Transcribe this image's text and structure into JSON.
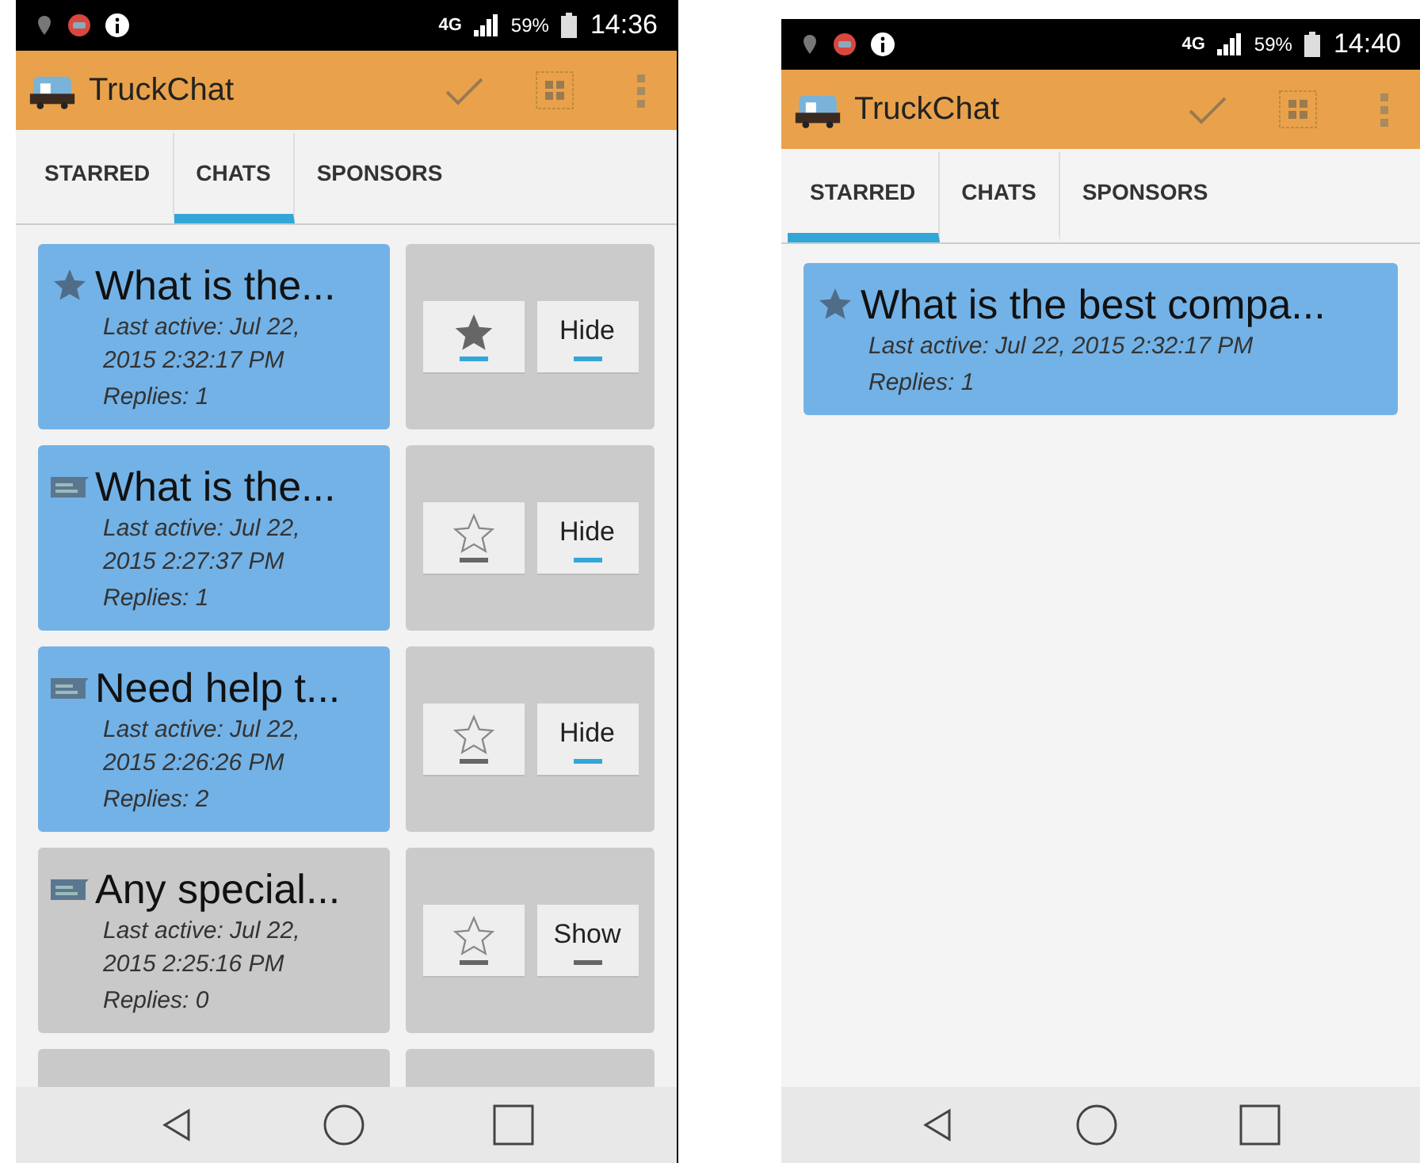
{
  "screens": [
    {
      "status_bar": {
        "network": "4G",
        "battery": "59%",
        "time": "14:36"
      },
      "app_title": "TruckChat",
      "tabs": [
        {
          "label": "STARRED",
          "selected": false
        },
        {
          "label": "CHATS",
          "selected": true
        },
        {
          "label": "SPONSORS",
          "selected": false
        }
      ],
      "threads": [
        {
          "title": "What is the...",
          "starred": true,
          "hidden": false,
          "last_active": "Last active: Jul 22, 2015 2:32:17 PM",
          "replies": "Replies: 1",
          "action": "Hide"
        },
        {
          "title": "What is the...",
          "starred": false,
          "hidden": false,
          "last_active": "Last active: Jul 22, 2015 2:27:37 PM",
          "replies": "Replies: 1",
          "action": "Hide"
        },
        {
          "title": "Need help t...",
          "starred": false,
          "hidden": false,
          "last_active": "Last active: Jul 22, 2015 2:26:26 PM",
          "replies": "Replies: 2",
          "action": "Hide"
        },
        {
          "title": "Any special...",
          "starred": false,
          "hidden": true,
          "last_active": "Last active: Jul 22, 2015 2:25:16 PM",
          "replies": "Replies: 0",
          "action": "Show"
        }
      ],
      "cut_off_row": true
    },
    {
      "status_bar": {
        "network": "4G",
        "battery": "59%",
        "time": "14:40"
      },
      "app_title": "TruckChat",
      "tabs": [
        {
          "label": "STARRED",
          "selected": true
        },
        {
          "label": "CHATS",
          "selected": false
        },
        {
          "label": "SPONSORS",
          "selected": false
        }
      ],
      "threads": [
        {
          "title": "What is the best compa...",
          "starred": true,
          "hidden": false,
          "last_active": "Last active: Jul 22, 2015 2:32:17 PM",
          "replies": "Replies: 1"
        }
      ],
      "cut_off_row": false
    }
  ]
}
